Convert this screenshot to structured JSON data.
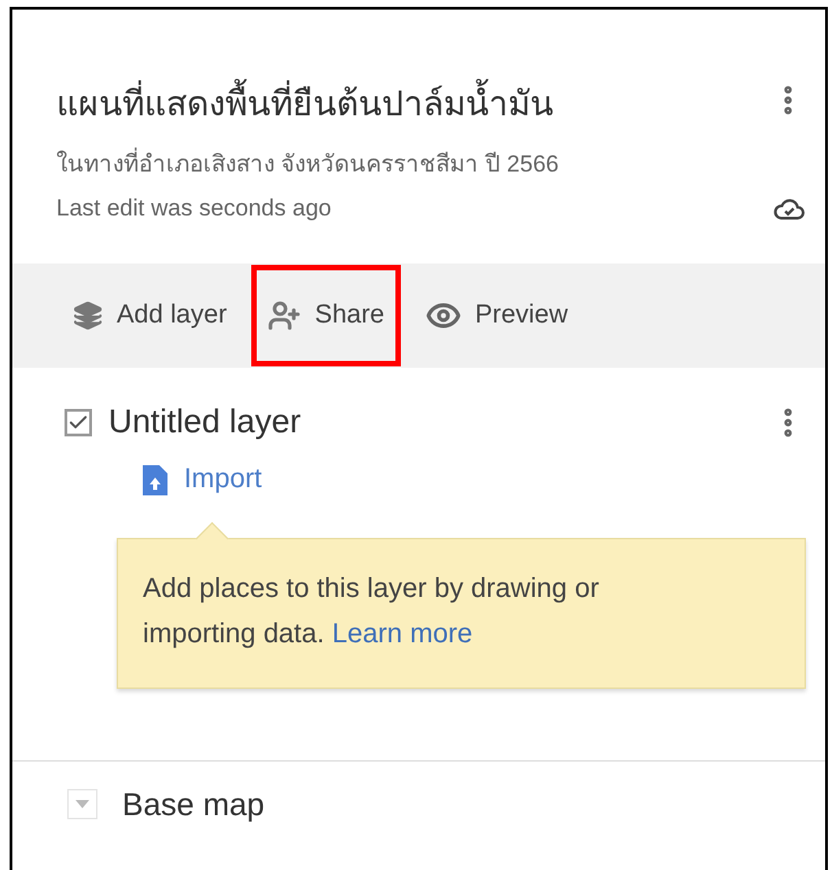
{
  "map": {
    "title": "แผนที่แสดงพื้นที่ยืนต้นปาล์มน้ำมัน",
    "description": "ในทางที่อำเภอเสิงสาง จังหวัดนครราชสีมา ปี 2566",
    "status": "Last edit was seconds ago"
  },
  "toolbar": [
    {
      "label": "Add layer",
      "kind": "add-layer",
      "highlighted": false
    },
    {
      "label": "Share",
      "kind": "share",
      "highlighted": true
    },
    {
      "label": "Preview",
      "kind": "preview",
      "highlighted": false
    }
  ],
  "layers": [
    {
      "name": "Untitled layer",
      "checked": true,
      "action": "Import",
      "tip": {
        "text": "Add places to this layer by drawing or importing data.",
        "link": "Learn more"
      }
    }
  ],
  "base_map": {
    "label": "Base map"
  }
}
